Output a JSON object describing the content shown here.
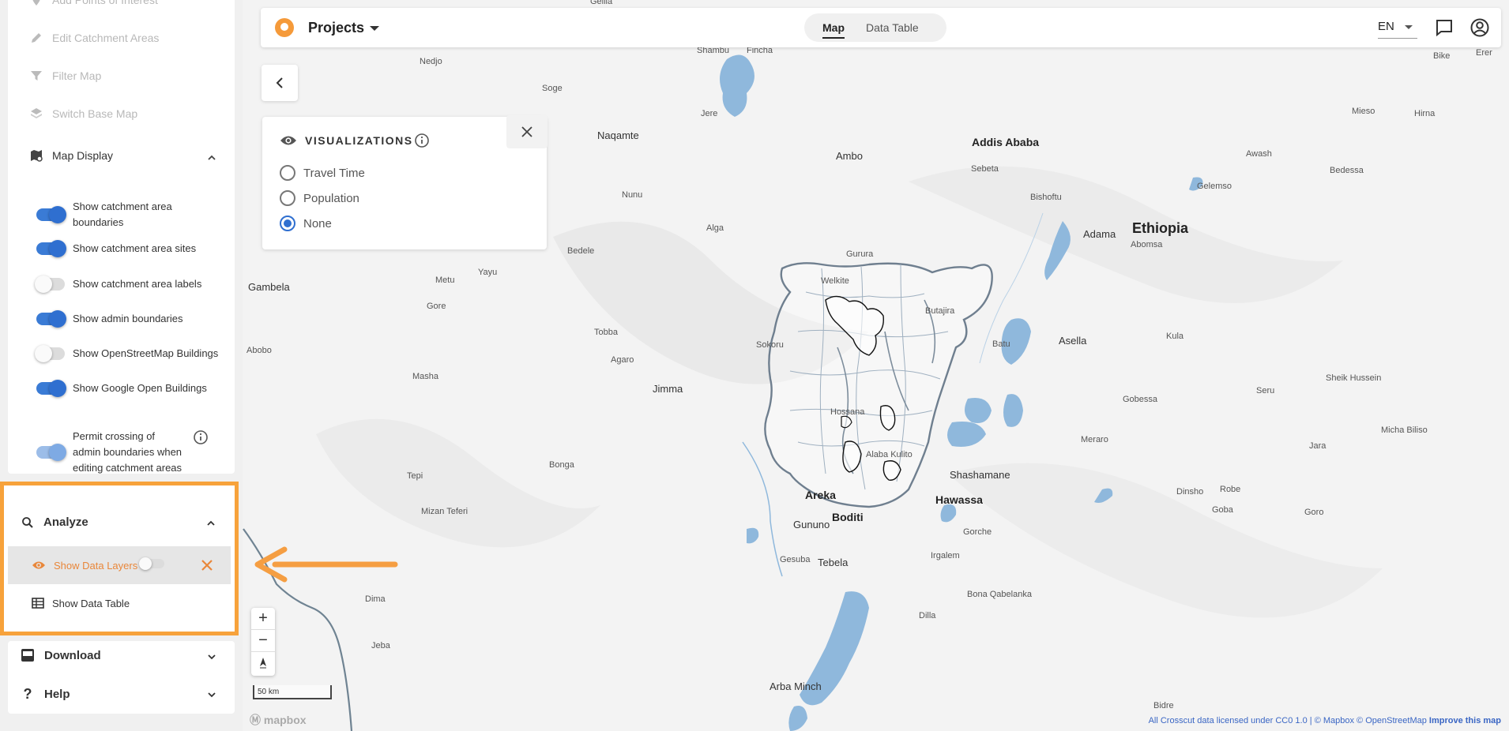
{
  "sidebar": {
    "tools": [
      {
        "label": "Add Points of Interest",
        "icon": "pin-icon"
      },
      {
        "label": "Edit Catchment Areas",
        "icon": "pencil-icon"
      },
      {
        "label": "Filter Map",
        "icon": "filter-icon"
      },
      {
        "label": "Switch Base Map",
        "icon": "layers-icon"
      }
    ],
    "map_display": {
      "title": "Map Display",
      "toggles": [
        {
          "label": "Show catchment area boundaries",
          "on": true
        },
        {
          "label": "Show catchment area sites",
          "on": true
        },
        {
          "label": "Show catchment area labels",
          "on": false
        },
        {
          "label": "Show admin boundaries",
          "on": true
        },
        {
          "label": "Show OpenStreetMap Buildings",
          "on": false
        },
        {
          "label": "Show Google Open Buildings",
          "on": true
        },
        {
          "label": "Permit crossing of admin boundaries when editing catchment areas",
          "on": true
        }
      ]
    },
    "analyze": {
      "title": "Analyze",
      "show_data_layers": "Show Data Layers",
      "show_data_table": "Show Data Table"
    },
    "download": "Download",
    "help": "Help"
  },
  "topbar": {
    "project_label": "Projects",
    "tabs": [
      "Map",
      "Data Table"
    ],
    "active_tab": "Map",
    "language": "EN"
  },
  "visualizations": {
    "title": "VISUALIZATIONS",
    "options": [
      "Travel Time",
      "Population",
      "None"
    ],
    "selected": "None"
  },
  "map": {
    "scale_label": "50 km",
    "logo_text": "mapbox",
    "attribution": "All Crosscut data licensed under CC0 1.0 | © Mapbox © OpenStreetMap",
    "improve_link": "Improve this map",
    "places": [
      {
        "name": "Gelila"
      },
      {
        "name": "Nedjo"
      },
      {
        "name": "Soge"
      },
      {
        "name": "Shambu"
      },
      {
        "name": "Fincha"
      },
      {
        "name": "Jere"
      },
      {
        "name": "Naqamte"
      },
      {
        "name": "Ambo"
      },
      {
        "name": "Addis Ababa"
      },
      {
        "name": "Sebeta"
      },
      {
        "name": "Bishoftu"
      },
      {
        "name": "Adama"
      },
      {
        "name": "Ethiopia"
      },
      {
        "name": "Abomsa"
      },
      {
        "name": "Nunu"
      },
      {
        "name": "Alga"
      },
      {
        "name": "Bedele"
      },
      {
        "name": "Gurura"
      },
      {
        "name": "Welkite"
      },
      {
        "name": "Butajira"
      },
      {
        "name": "Gambela"
      },
      {
        "name": "Metu"
      },
      {
        "name": "Yayu"
      },
      {
        "name": "Gore"
      },
      {
        "name": "Tobba"
      },
      {
        "name": "Agaro"
      },
      {
        "name": "Sokoru"
      },
      {
        "name": "Batu"
      },
      {
        "name": "Asella"
      },
      {
        "name": "Abobo"
      },
      {
        "name": "Masha"
      },
      {
        "name": "Jimma"
      },
      {
        "name": "Hossana"
      },
      {
        "name": "Alaba Kulito"
      },
      {
        "name": "Merarо"
      },
      {
        "name": "Gobessa"
      },
      {
        "name": "Tepi"
      },
      {
        "name": "Bonga"
      },
      {
        "name": "Mizan Teferi"
      },
      {
        "name": "Areka"
      },
      {
        "name": "Shashamane"
      },
      {
        "name": "Hawassa"
      },
      {
        "name": "Gununo"
      },
      {
        "name": "Boditi"
      },
      {
        "name": "Gesuba"
      },
      {
        "name": "Tebela"
      },
      {
        "name": "Gorche"
      },
      {
        "name": "Irgalem"
      },
      {
        "name": "Dima"
      },
      {
        "name": "Dilla"
      },
      {
        "name": "Bona Qabelanka"
      },
      {
        "name": "Jeba"
      },
      {
        "name": "Arba Minch"
      },
      {
        "name": "Bidre"
      },
      {
        "name": "Bike"
      },
      {
        "name": "Erer"
      },
      {
        "name": "Mieso"
      },
      {
        "name": "Hirna"
      },
      {
        "name": "Awash"
      },
      {
        "name": "Bedessa"
      },
      {
        "name": "Gelemso"
      },
      {
        "name": "Kula"
      },
      {
        "name": "Seru"
      },
      {
        "name": "Sheik Hussein"
      },
      {
        "name": "Micha Biliso"
      },
      {
        "name": "Jara"
      },
      {
        "name": "Dinsho"
      },
      {
        "name": "Robe"
      },
      {
        "name": "Goba"
      },
      {
        "name": "Goro"
      }
    ]
  },
  "colors": {
    "accent_orange": "#f7a23b",
    "toggle_blue": "#2f6fd0",
    "water": "#8fb8dc",
    "boundary": "#6f7f8f"
  }
}
